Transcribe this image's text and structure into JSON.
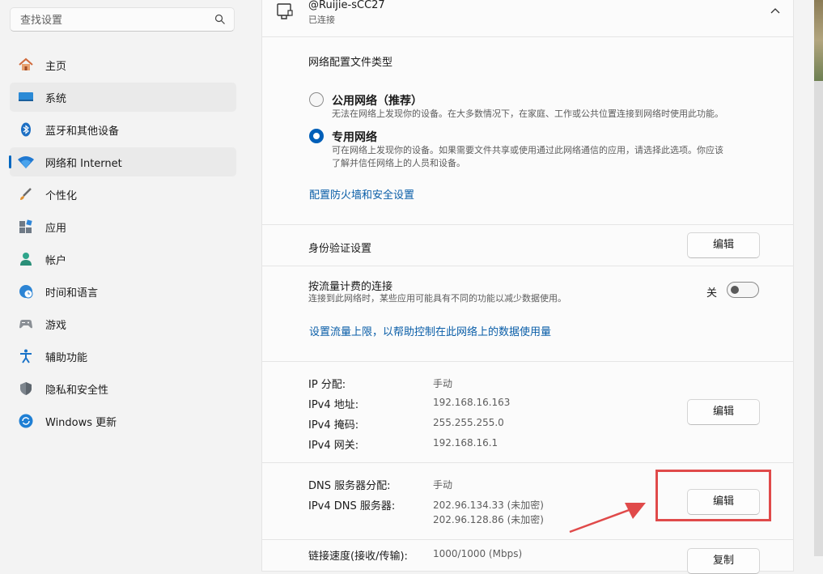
{
  "search": {
    "placeholder": "查找设置"
  },
  "sidebar": {
    "items": [
      {
        "label": "主页",
        "icon": "home-icon"
      },
      {
        "label": "系统",
        "icon": "system-icon"
      },
      {
        "label": "蓝牙和其他设备",
        "icon": "bluetooth-icon"
      },
      {
        "label": "网络和 Internet",
        "icon": "wifi-icon"
      },
      {
        "label": "个性化",
        "icon": "brush-icon"
      },
      {
        "label": "应用",
        "icon": "apps-icon"
      },
      {
        "label": "帐户",
        "icon": "account-icon"
      },
      {
        "label": "时间和语言",
        "icon": "globe-clock-icon"
      },
      {
        "label": "游戏",
        "icon": "gamepad-icon"
      },
      {
        "label": "辅助功能",
        "icon": "accessibility-icon"
      },
      {
        "label": "隐私和安全性",
        "icon": "shield-icon"
      },
      {
        "label": "Windows 更新",
        "icon": "update-icon"
      }
    ]
  },
  "connection": {
    "name": "@Ruijie-sCC27",
    "status": "已连接"
  },
  "profile": {
    "heading": "网络配置文件类型",
    "public_label": "公用网络（推荐）",
    "public_desc": "无法在网络上发现你的设备。在大多数情况下，在家庭、工作或公共位置连接到网络时使用此功能。",
    "private_label": "专用网络",
    "private_desc_1": "可在网络上发现你的设备。如果需要文件共享或使用通过此网络通信的应用，请选择此选项。你应该",
    "private_desc_2": "了解并信任网络上的人员和设备。",
    "selected": "private",
    "firewall_link": "配置防火墙和安全设置"
  },
  "auth": {
    "label": "身份验证设置",
    "button": "编辑"
  },
  "metered": {
    "label": "按流量计费的连接",
    "desc": "连接到此网络时，某些应用可能具有不同的功能以减少数据使用。",
    "toggle_state": "关",
    "link": "设置流量上限，以帮助控制在此网络上的数据使用量"
  },
  "ip": {
    "rows": [
      {
        "label": "IP 分配:",
        "value": "手动"
      },
      {
        "label": "IPv4 地址:",
        "value": "192.168.16.163"
      },
      {
        "label": "IPv4 掩码:",
        "value": "255.255.255.0"
      },
      {
        "label": "IPv4 网关:",
        "value": "192.168.16.1"
      }
    ],
    "button": "编辑"
  },
  "dns": {
    "assign_label": "DNS 服务器分配:",
    "assign_value": "手动",
    "server_label": "IPv4 DNS 服务器:",
    "server_1": "202.96.134.33 (未加密)",
    "server_2": "202.96.128.86 (未加密)",
    "button": "编辑"
  },
  "link_speed": {
    "label": "链接速度(接收/传输):",
    "value": "1000/1000 (Mbps)",
    "button": "复制"
  },
  "colors": {
    "accent": "#005fb8",
    "highlight_box": "#e04a4a",
    "link": "#0a5ea8"
  }
}
